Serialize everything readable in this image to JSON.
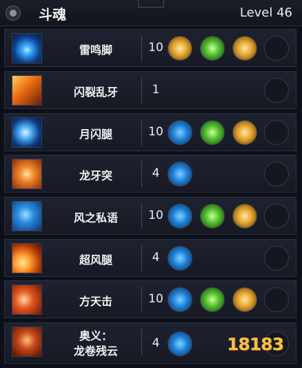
{
  "header": {
    "title": "斗魂",
    "level": "Level 46",
    "menu_icon": "circle-menu-icon"
  },
  "skills": [
    {
      "name": "雷鸣脚",
      "count": "10",
      "icon": "lightning-kick-icon",
      "runes": [
        "sprint-rune-icon",
        "green-slash-rune-icon",
        "gold-arrow-rune-icon"
      ]
    },
    {
      "name": "闪裂乱牙",
      "count": "1",
      "icon": "flash-fang-icon",
      "runes": []
    },
    {
      "name": "月闪腿",
      "count": "10",
      "icon": "moon-flash-icon",
      "runes": [
        "blue-flame-rune-icon",
        "green-target-rune-icon",
        "gold-cross-rune-icon"
      ]
    },
    {
      "name": "龙牙突",
      "count": "4",
      "icon": "dragon-fang-icon",
      "runes": [
        "blue-pierce-rune-icon"
      ]
    },
    {
      "name": "风之私语",
      "count": "10",
      "icon": "wind-whisper-icon",
      "runes": [
        "blue-boot-rune-icon",
        "green-hourglass-rune-icon",
        "gold-wind-rune-icon"
      ]
    },
    {
      "name": "超风腿",
      "count": "4",
      "icon": "super-wind-icon",
      "runes": [
        "blue-lightning-rune-icon"
      ]
    },
    {
      "name": "方天击",
      "count": "10",
      "icon": "heaven-strike-icon",
      "runes": [
        "blue-skull-rune-icon",
        "green-target-rune-icon",
        "gold-cross-rune-icon"
      ]
    },
    {
      "name": "奥义：龙卷残云",
      "name_line1": "奥义：",
      "name_line2": "龙卷残云",
      "count": "4",
      "icon": "tornado-cloud-icon",
      "runes": [
        "blue-lightning-rune-icon"
      ]
    }
  ],
  "watermark": "18183",
  "colors": {
    "blue_rune": "#1d7fd6",
    "green_rune": "#4cb82a",
    "gold_rune": "#e0a12a"
  }
}
